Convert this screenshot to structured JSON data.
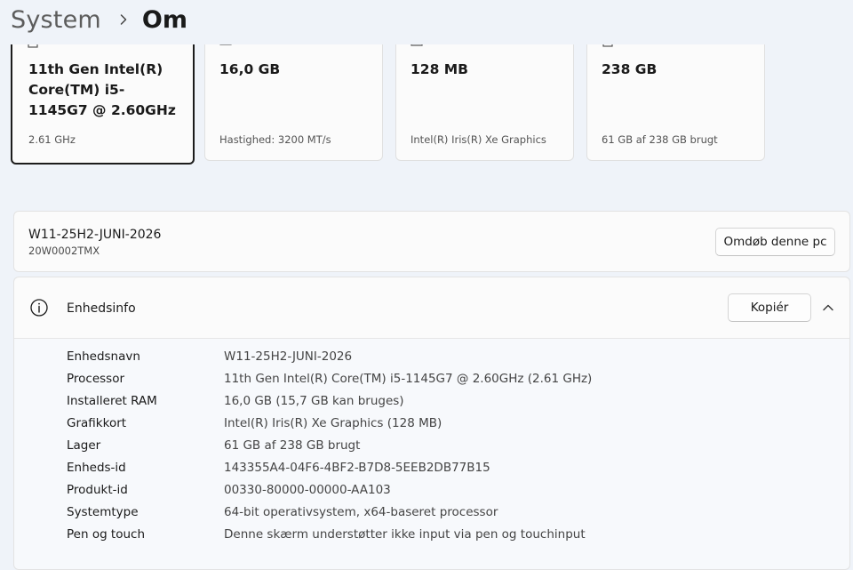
{
  "breadcrumb": {
    "parent": "System",
    "current": "Om"
  },
  "spec_cards": [
    {
      "icon": "processor-icon",
      "value": "11th Gen Intel(R) Core(TM) i5-1145G7 @ 2.60GHz",
      "sub": "2.61 GHz"
    },
    {
      "icon": "ram-icon",
      "value": "16,0 GB",
      "sub": "Hastighed: 3200 MT/s"
    },
    {
      "icon": "graphics-icon",
      "value": "128 MB",
      "sub": "Intel(R) Iris(R) Xe Graphics"
    },
    {
      "icon": "storage-icon",
      "value": "238 GB",
      "sub": "61 GB af 238 GB brugt"
    }
  ],
  "device": {
    "name": "W11-25H2-JUNI-2026",
    "model": "20W0002TMX",
    "rename_label": "Omdøb denne pc"
  },
  "device_info": {
    "title": "Enhedsinfo",
    "copy_label": "Kopiér",
    "rows": [
      {
        "label": "Enhedsnavn",
        "value": "W11-25H2-JUNI-2026"
      },
      {
        "label": "Processor",
        "value": "11th Gen Intel(R) Core(TM) i5-1145G7 @ 2.60GHz (2.61 GHz)"
      },
      {
        "label": "Installeret RAM",
        "value": "16,0 GB (15,7 GB kan bruges)"
      },
      {
        "label": "Grafikkort",
        "value": "Intel(R) Iris(R) Xe Graphics (128 MB)"
      },
      {
        "label": "Lager",
        "value": "61 GB af 238 GB brugt"
      },
      {
        "label": "Enheds-id",
        "value": "143355A4-04F6-4BF2-B7D8-5EEB2DB77B15"
      },
      {
        "label": "Produkt-id",
        "value": "00330-80000-00000-AA103"
      },
      {
        "label": "Systemtype",
        "value": "64-bit operativsystem, x64-baseret processor"
      },
      {
        "label": "Pen og touch",
        "value": "Denne skærm understøtter ikke input via pen og touchinput"
      }
    ]
  },
  "colors": {
    "background": "#eff3f9",
    "card": "#fbfbfb",
    "selected_border": "#1c1c1c"
  }
}
